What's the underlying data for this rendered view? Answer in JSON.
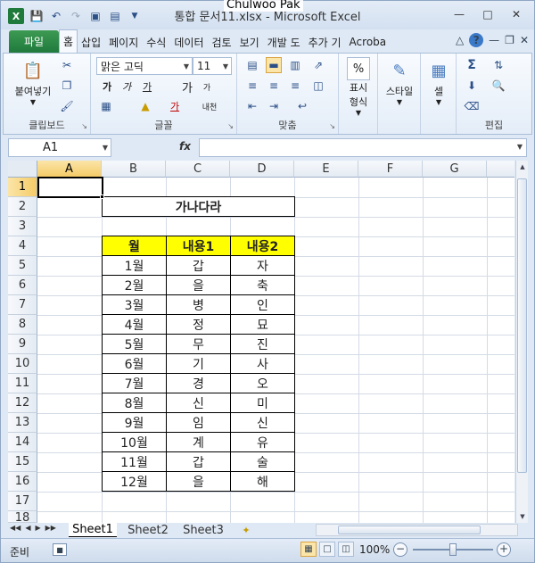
{
  "titlebar": {
    "doc_title": "통합 문서11.xlsx - Microsoft Excel",
    "user_overlay": "Chulwoo Pak"
  },
  "tabs": {
    "file": "파일",
    "items": [
      "홈",
      "삽입",
      "페이지",
      "수식",
      "데이터",
      "검토",
      "보기",
      "개발 도",
      "추가 기",
      "Acroba"
    ]
  },
  "ribbon": {
    "clipboard": {
      "paste": "붙여넣기",
      "label": "클립보드"
    },
    "font": {
      "name": "맑은 고딕",
      "size": "11",
      "label": "글꼴",
      "bold": "가",
      "italic": "가",
      "underline": "가",
      "grow": "가",
      "shrink": "가",
      "color_text": "가",
      "phonetic": "내천"
    },
    "alignment": {
      "label": "맞춤"
    },
    "number": {
      "btn": "표시\n형식",
      "btn_line1": "표시",
      "btn_line2": "형식",
      "pct": "%"
    },
    "styles": {
      "btn": "스타일"
    },
    "cells": {
      "btn": "셀"
    },
    "editing": {
      "label": "편집",
      "sigma": "Σ"
    }
  },
  "formula_bar": {
    "name_box": "A1",
    "fx": "fx",
    "value": ""
  },
  "grid": {
    "columns": [
      "A",
      "B",
      "C",
      "D",
      "E",
      "F",
      "G"
    ],
    "rows": [
      "1",
      "2",
      "3",
      "4",
      "5",
      "6",
      "7",
      "8",
      "9",
      "10",
      "11",
      "12",
      "13",
      "14",
      "15",
      "16",
      "17",
      "18"
    ],
    "title": "가나다라",
    "table_headers": [
      "월",
      "내용1",
      "내용2"
    ],
    "table_rows": [
      [
        "1월",
        "갑",
        "자"
      ],
      [
        "2월",
        "을",
        "축"
      ],
      [
        "3월",
        "병",
        "인"
      ],
      [
        "4월",
        "정",
        "묘"
      ],
      [
        "5월",
        "무",
        "진"
      ],
      [
        "6월",
        "기",
        "사"
      ],
      [
        "7월",
        "경",
        "오"
      ],
      [
        "8월",
        "신",
        "미"
      ],
      [
        "9월",
        "임",
        "신"
      ],
      [
        "10월",
        "계",
        "유"
      ],
      [
        "11월",
        "갑",
        "술"
      ],
      [
        "12월",
        "을",
        "해"
      ]
    ],
    "header_fill": "#ffff00"
  },
  "sheets": {
    "tabs": [
      "Sheet1",
      "Sheet2",
      "Sheet3"
    ],
    "active": "Sheet1"
  },
  "status": {
    "ready": "준비",
    "zoom": "100%"
  },
  "colors": {
    "file_tab": "#1f7a3c",
    "selection_header": "#f5cb67",
    "accent": "#2b4f87"
  }
}
